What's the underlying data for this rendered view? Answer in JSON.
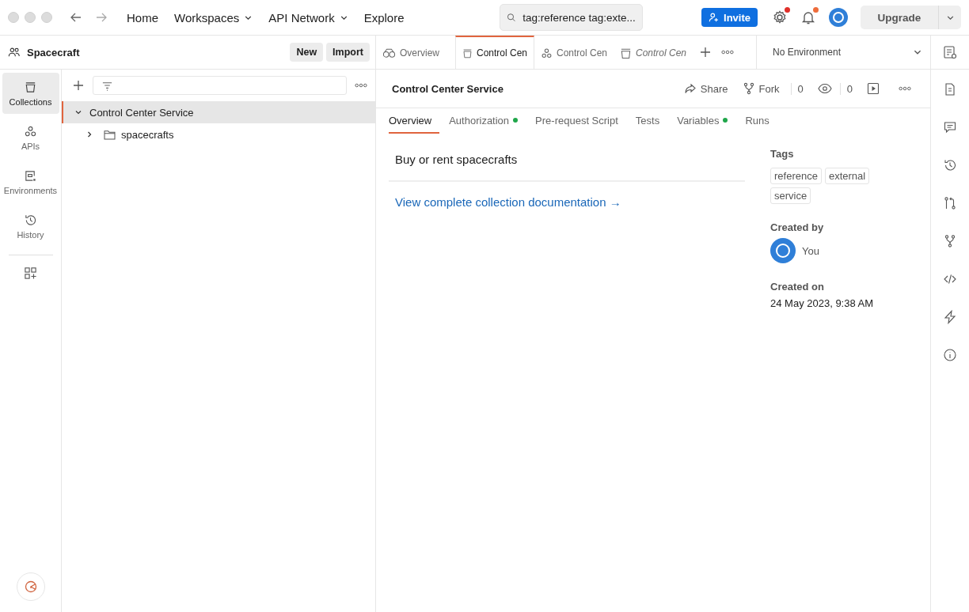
{
  "titlebar": {
    "nav": [
      {
        "label": "Home",
        "dropdown": false
      },
      {
        "label": "Workspaces",
        "dropdown": true
      },
      {
        "label": "API Network",
        "dropdown": true
      },
      {
        "label": "Explore",
        "dropdown": false
      }
    ],
    "search": {
      "value": "tag:reference tag:exte..."
    },
    "invite": "Invite",
    "settings_badge": true,
    "notifications_badge": true,
    "upgrade": "Upgrade"
  },
  "workspace": {
    "name": "Spacecraft",
    "buttons": [
      "New",
      "Import"
    ]
  },
  "sidebar": {
    "items": [
      {
        "label": "Collections",
        "selected": true
      },
      {
        "label": "APIs",
        "selected": false
      },
      {
        "label": "Environments",
        "selected": false
      },
      {
        "label": "History",
        "selected": false
      }
    ]
  },
  "tree": [
    {
      "label": "Control Center Service",
      "expanded": true,
      "selected": true,
      "children": [
        {
          "label": "spacecrafts",
          "expanded": false,
          "selected": false
        }
      ]
    }
  ],
  "tabs": [
    {
      "label": "Overview",
      "kind": "overview",
      "selected": false,
      "preview": false
    },
    {
      "label": "Control Cen",
      "kind": "collection",
      "selected": true,
      "preview": false
    },
    {
      "label": "Control Cen",
      "kind": "api",
      "selected": false,
      "preview": false
    },
    {
      "label": "Control Cen",
      "kind": "collection",
      "selected": false,
      "preview": true
    }
  ],
  "environment": {
    "label": "No Environment"
  },
  "collection": {
    "title": "Control Center Service",
    "share": "Share",
    "fork": "Fork",
    "fork_count": "0",
    "watch_count": "0"
  },
  "subtabs": [
    {
      "label": "Overview",
      "selected": true,
      "dot": false
    },
    {
      "label": "Authorization",
      "selected": false,
      "dot": true
    },
    {
      "label": "Pre-request Script",
      "selected": false,
      "dot": false
    },
    {
      "label": "Tests",
      "selected": false,
      "dot": false
    },
    {
      "label": "Variables",
      "selected": false,
      "dot": true
    },
    {
      "label": "Runs",
      "selected": false,
      "dot": false
    }
  ],
  "description": "Buy or rent spacecrafts",
  "doc_link": "View complete collection documentation →",
  "info": {
    "tags_label": "Tags",
    "tags": [
      "reference",
      "external",
      "service"
    ],
    "created_by_label": "Created by",
    "created_by": "You",
    "created_on_label": "Created on",
    "created_on": "24 May 2023, 9:38 AM"
  }
}
